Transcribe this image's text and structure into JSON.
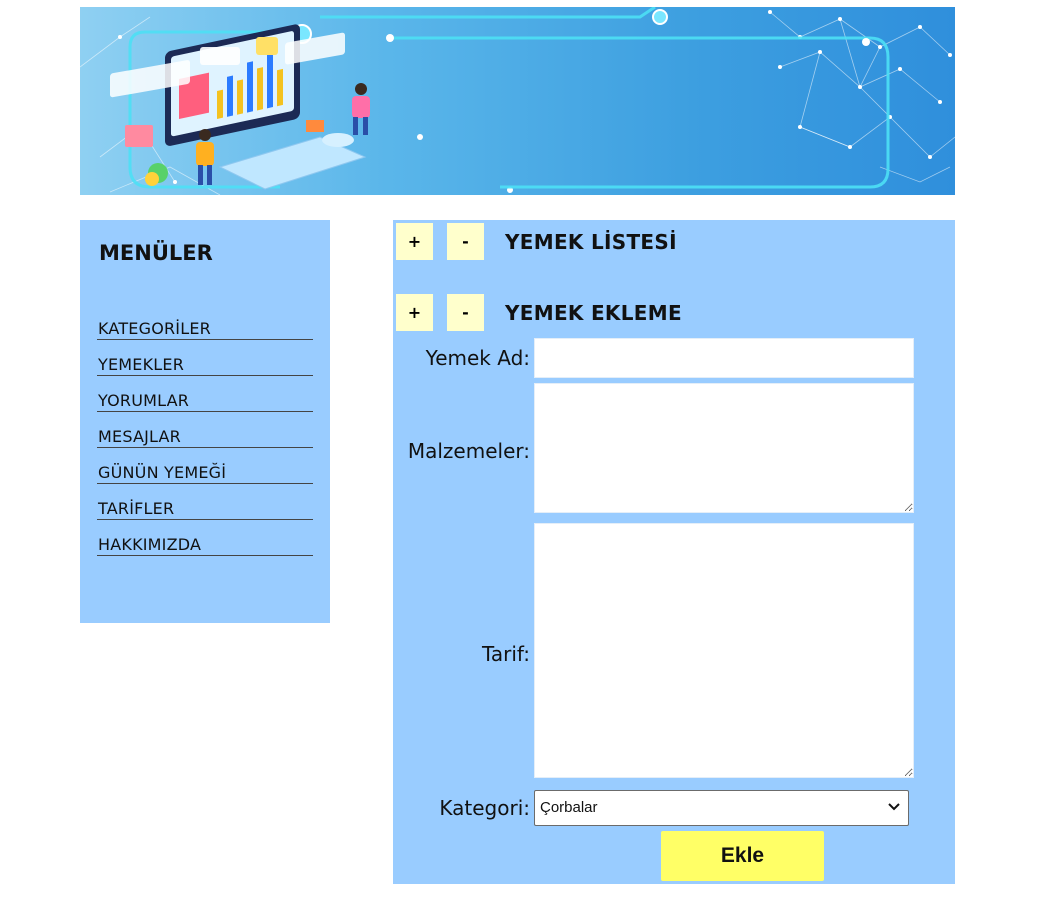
{
  "sidebar": {
    "title": "MENÜLER",
    "items": [
      {
        "label": "KATEGORİLER"
      },
      {
        "label": "YEMEKLER"
      },
      {
        "label": "YORUMLAR"
      },
      {
        "label": "MESAJLAR"
      },
      {
        "label": "GÜNÜN YEMEĞİ"
      },
      {
        "label": "TARİFLER"
      },
      {
        "label": "HAKKIMIZDA"
      }
    ]
  },
  "main": {
    "list_section": {
      "plus": "+",
      "minus": "-",
      "title": "YEMEK LİSTESİ"
    },
    "add_section": {
      "plus": "+",
      "minus": "-",
      "title": "YEMEK EKLEME"
    },
    "form": {
      "name_label": "Yemek Ad:",
      "name_value": "",
      "ingredients_label": "Malzemeler:",
      "ingredients_value": "",
      "recipe_label": "Tarif:",
      "recipe_value": "",
      "category_label": "Kategori:",
      "category_selected": "Çorbalar",
      "submit_label": "Ekle"
    }
  },
  "colors": {
    "panel": "#99ccff",
    "toggle_button": "#ffffcc",
    "submit_button": "#ffff66"
  },
  "icons": {
    "banner": "data-analytics-illustration",
    "select_arrow": "chevron-down-icon"
  }
}
